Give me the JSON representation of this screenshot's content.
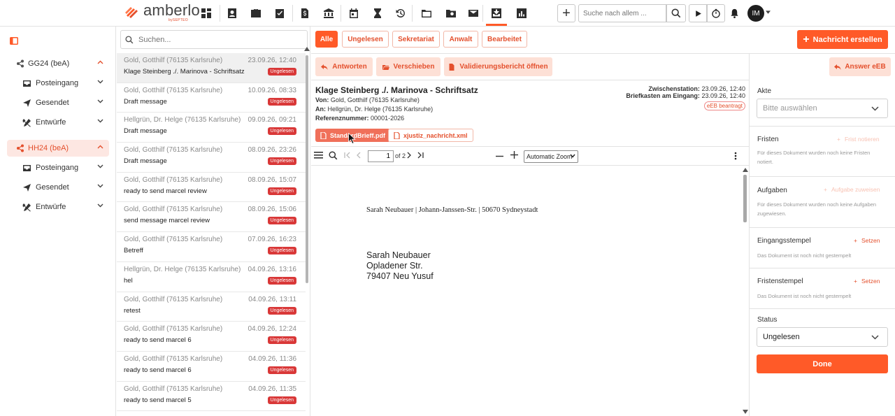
{
  "app": {
    "brand": "amberlo",
    "brand_sub": "bySEPTEO",
    "accent": "#ff5a28",
    "badge_color": "#d93838"
  },
  "topnav": {
    "icons": [
      "dashboard-icon",
      "contacts-icon",
      "briefcase-icon",
      "tasks-icon",
      "invoice-icon",
      "bank-icon",
      "calendar-icon",
      "hourglass-icon",
      "history-icon",
      "folder-icon",
      "folder-search-icon",
      "mail-icon",
      "bea-inbox-icon",
      "reports-icon"
    ],
    "search_placeholder": "Suche nach allem ...",
    "avatar_initials": "IM"
  },
  "sidebar": {
    "groups": [
      {
        "label": "GG24 (beA)",
        "items": [
          "Posteingang",
          "Gesendet",
          "Entwürfe"
        ]
      },
      {
        "label": "HH24 (beA)",
        "items": [
          "Posteingang",
          "Gesendet",
          "Entwürfe"
        ]
      }
    ]
  },
  "list": {
    "search_placeholder": "Suchen...",
    "messages": [
      {
        "sender": "Gold, Gotthilf (76135 Karlsruhe)",
        "date": "23.09.26, 12:40",
        "subject": "Klage Steinberg ./. Marinova - Schriftsatz",
        "badge": "Ungelesen"
      },
      {
        "sender": "Gold, Gotthilf (76135 Karlsruhe)",
        "date": "10.09.26, 08:33",
        "subject": "Draft message",
        "badge": "Ungelesen"
      },
      {
        "sender": "Hellgrün, Dr. Helge (76135 Karlsruhe)",
        "date": "09.09.26, 09:21",
        "subject": "Draft message",
        "badge": "Ungelesen"
      },
      {
        "sender": "Gold, Gotthilf (76135 Karlsruhe)",
        "date": "08.09.26, 23:26",
        "subject": "Draft message",
        "badge": "Ungelesen"
      },
      {
        "sender": "Gold, Gotthilf (76135 Karlsruhe)",
        "date": "08.09.26, 15:07",
        "subject": "ready to send marcel review",
        "badge": "Ungelesen"
      },
      {
        "sender": "Gold, Gotthilf (76135 Karlsruhe)",
        "date": "08.09.26, 15:06",
        "subject": "send message marcel review",
        "badge": "Ungelesen"
      },
      {
        "sender": "Gold, Gotthilf (76135 Karlsruhe)",
        "date": "07.09.26, 16:23",
        "subject": "Betreff",
        "badge": "Ungelesen"
      },
      {
        "sender": "Hellgrün, Dr. Helge (76135 Karlsruhe)",
        "date": "04.09.26, 13:16",
        "subject": "hel",
        "badge": "Ungelesen"
      },
      {
        "sender": "Gold, Gotthilf (76135 Karlsruhe)",
        "date": "04.09.26, 13:11",
        "subject": "retest",
        "badge": "Ungelesen"
      },
      {
        "sender": "Gold, Gotthilf (76135 Karlsruhe)",
        "date": "04.09.26, 12:24",
        "subject": "ready to send marcel 6",
        "badge": "Ungelesen"
      },
      {
        "sender": "Gold, Gotthilf (76135 Karlsruhe)",
        "date": "04.09.26, 11:36",
        "subject": "ready to send marcel 6",
        "badge": "Ungelesen"
      },
      {
        "sender": "Gold, Gotthilf (76135 Karlsruhe)",
        "date": "04.09.26, 11:35",
        "subject": "ready to send marcel 5",
        "badge": "Ungelesen"
      }
    ]
  },
  "filters": [
    "Alle",
    "Ungelesen",
    "Sekretariat",
    "Anwalt",
    "Bearbeitet"
  ],
  "new_message": "Nachricht erstellen",
  "actions": {
    "reply": "Antworten",
    "move": "Verschieben",
    "validation": "Validierungsbericht öffnen",
    "answer_eeb": "Answer eEB"
  },
  "message": {
    "title": "Klage Steinberg ./. Marinova - Schriftsatz",
    "from_label": "Von:",
    "from": "Gold, Gotthilf (76135 Karlsruhe)",
    "to_label": "An:",
    "to": "Hellgrün, Dr. Helge (76135 Karlsruhe)",
    "ref_label": "Referenznummer:",
    "ref": "00001-2026",
    "intermediate_label": "Zwischenstation:",
    "intermediate": "23.09.26, 12:40",
    "mailbox_label": "Briefkasten am Eingang:",
    "mailbox": "23.09.26, 12:40",
    "eeb_tag": "eEB beantragt",
    "attachments": [
      "StandardBrieff.pdf",
      "xjustiz_nachricht.xml"
    ]
  },
  "pdf": {
    "page": "1",
    "of": "of 2",
    "zoom": "Automatic Zoom",
    "sender_line": "Sarah Neubauer | Johann-Janssen-Str. | 50670 Sydneystadt",
    "address": [
      "Sarah Neubauer",
      "Opladener Str.",
      "79407 Neu Yusuf"
    ]
  },
  "right": {
    "akte_label": "Akte",
    "akte_placeholder": "Bitte auswählen",
    "fristen_label": "Fristen",
    "fristen_action": "Frist notieren",
    "fristen_hint": "Für dieses Dokument wurden noch keine Fristen notiert.",
    "aufgaben_label": "Aufgaben",
    "aufgaben_action": "Aufgabe zuweisen",
    "aufgaben_hint": "Für dieses Dokument wurden noch keine Aufgaben zugewiesen.",
    "eingang_label": "Eingangsstempel",
    "eingang_action": "Setzen",
    "eingang_hint": "Das Dokument ist noch nicht gestempelt",
    "fristen_stempel_label": "Fristenstempel",
    "fristen_stempel_action": "Setzen",
    "fristen_stempel_hint": "Das Dokument ist noch nicht gestempelt",
    "status_label": "Status",
    "status_value": "Ungelesen",
    "done": "Done"
  }
}
